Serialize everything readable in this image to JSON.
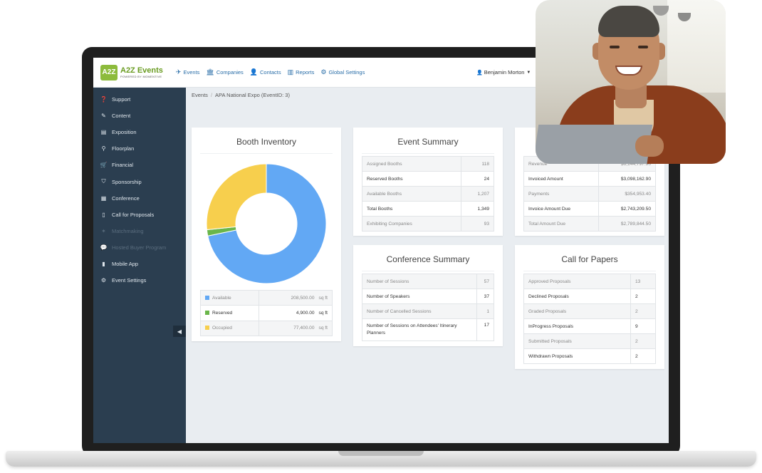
{
  "app": {
    "logo_badge": "A2Z",
    "logo_name": "A2Z Events",
    "logo_sub": "POWERED BY MOMENTIVE",
    "accent": "#8dbb3c",
    "link_color": "#2a6ea8"
  },
  "nav": {
    "items": [
      {
        "label": "Events",
        "icon": "plane-icon"
      },
      {
        "label": "Companies",
        "icon": "building-icon"
      },
      {
        "label": "Contacts",
        "icon": "person-icon"
      },
      {
        "label": "Reports",
        "icon": "bar-chart-icon"
      },
      {
        "label": "Global Settings",
        "icon": "gears-icon"
      }
    ],
    "user": "Benjamin Morton"
  },
  "sidebar": {
    "bg": "#2b3e50",
    "items": [
      {
        "label": "Support",
        "icon": "question-circle-icon",
        "enabled": true
      },
      {
        "label": "Content",
        "icon": "edit-icon",
        "enabled": true
      },
      {
        "label": "Exposition",
        "icon": "briefcase-icon",
        "enabled": true
      },
      {
        "label": "Floorplan",
        "icon": "map-marker-icon",
        "enabled": true
      },
      {
        "label": "Financial",
        "icon": "cart-icon",
        "enabled": true
      },
      {
        "label": "Sponsorship",
        "icon": "tags-icon",
        "enabled": true
      },
      {
        "label": "Conference",
        "icon": "calendar-icon",
        "enabled": true
      },
      {
        "label": "Call for Proposals",
        "icon": "file-icon",
        "enabled": true
      },
      {
        "label": "Matchmaking",
        "icon": "handshake-icon",
        "enabled": false
      },
      {
        "label": "Hosted Buyer Program",
        "icon": "comments-icon",
        "enabled": false
      },
      {
        "label": "Mobile App",
        "icon": "mobile-icon",
        "enabled": true
      },
      {
        "label": "Event Settings",
        "icon": "cog-icon",
        "enabled": true
      }
    ]
  },
  "breadcrumb": {
    "root": "Events",
    "separator": "/",
    "current": "APA National Expo (EventID: 3)"
  },
  "booth_inventory": {
    "title": "Booth Inventory",
    "chart_data": {
      "type": "pie",
      "categories": [
        "Available",
        "Reserved",
        "Occupied"
      ],
      "values": [
        208500,
        4900,
        77400
      ],
      "colors": [
        "#62a8f4",
        "#6ab64a",
        "#f7cf4d"
      ]
    },
    "legend": [
      {
        "label": "Available",
        "value": "208,500.00",
        "unit": "sq ft"
      },
      {
        "label": "Reserved",
        "value": "4,900.00",
        "unit": "sq ft"
      },
      {
        "label": "Occupied",
        "value": "77,400.00",
        "unit": "sq ft"
      }
    ]
  },
  "event_summary": {
    "title": "Event Summary",
    "rows": [
      {
        "label": "Assigned Booths",
        "value": "118"
      },
      {
        "label": "Reserved Booths",
        "value": "24"
      },
      {
        "label": "Available Booths",
        "value": "1,207"
      },
      {
        "label": "Total Booths",
        "value": "1,349"
      },
      {
        "label": "Exhibiting Companies",
        "value": "93"
      }
    ]
  },
  "financial_summary": {
    "rows": [
      {
        "label": "Revenue",
        "value": "$6,144,797.90"
      },
      {
        "label": "Invoiced Amount",
        "value": "$3,098,162.90"
      },
      {
        "label": "Payments",
        "value": "$354,953.40"
      },
      {
        "label": "Invoice Amount Due",
        "value": "$2,743,209.50"
      },
      {
        "label": "Total Amount Due",
        "value": "$2,789,844.50"
      }
    ]
  },
  "conference_summary": {
    "title": "Conference Summary",
    "rows": [
      {
        "label": "Number of Sessions",
        "value": "57"
      },
      {
        "label": "Number of Speakers",
        "value": "37"
      },
      {
        "label": "Number of Cancelled Sessions",
        "value": "1"
      },
      {
        "label": "Number of Sessions on Attendees' Itinerary Planners",
        "value": "17"
      }
    ]
  },
  "call_for_papers": {
    "title": "Call for Papers",
    "rows": [
      {
        "label": "Approved Proposals",
        "value": "13"
      },
      {
        "label": "Declined Proposals",
        "value": "2"
      },
      {
        "label": "Graded Proposals",
        "value": "2"
      },
      {
        "label": "InProgress Proposals",
        "value": "9"
      },
      {
        "label": "Submitted Proposals",
        "value": "2"
      },
      {
        "label": "Withdrawn Proposals",
        "value": "2"
      }
    ]
  }
}
